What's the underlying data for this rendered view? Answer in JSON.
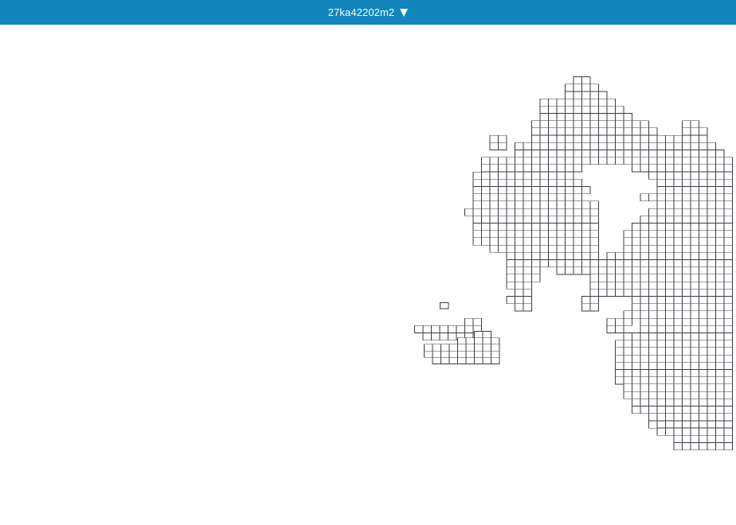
{
  "header": {
    "sheet_selector_label": "27ka42202m2",
    "dropdown_icon": "triangle-down-icon"
  },
  "map": {
    "grid_line_color": "#3c3c46",
    "header_color": "#1185bc"
  }
}
